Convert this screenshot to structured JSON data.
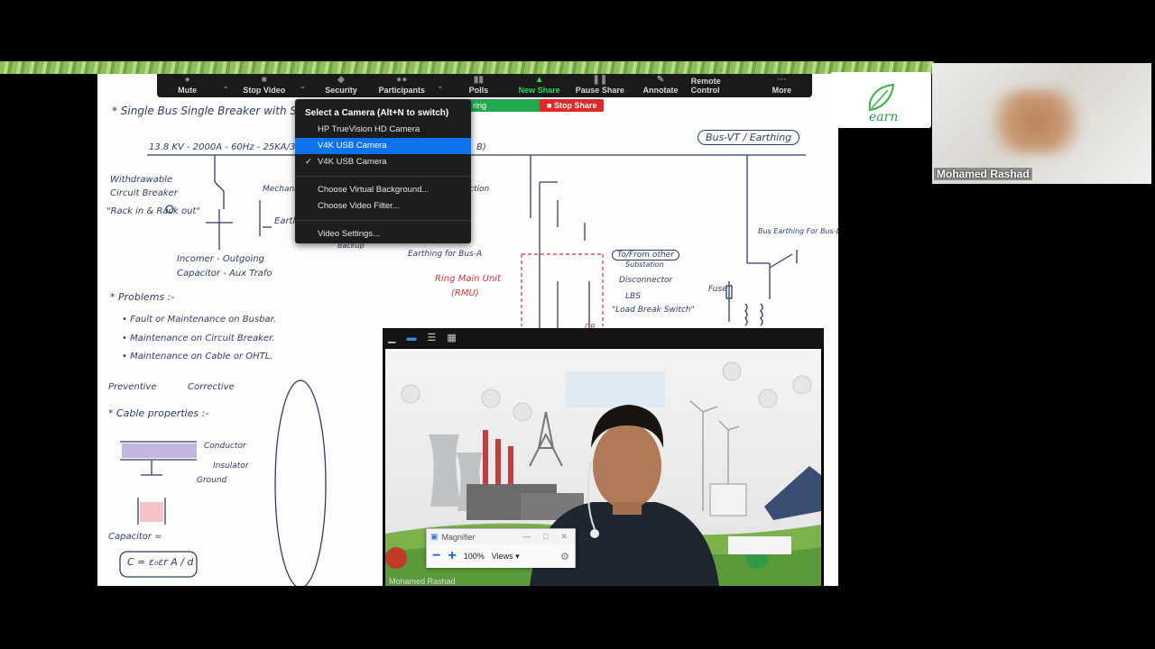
{
  "toolbar": {
    "items": [
      {
        "label": "Mute",
        "icon": "microphone-icon"
      },
      {
        "label": "Stop Video",
        "icon": "video-camera-icon"
      },
      {
        "label": "Security",
        "icon": "shield-icon"
      },
      {
        "label": "Participants",
        "icon": "participants-icon"
      },
      {
        "label": "Polls",
        "icon": "polls-icon"
      },
      {
        "label": "New Share",
        "icon": "share-arrow-icon"
      },
      {
        "label": "Pause Share",
        "icon": "pause-icon"
      },
      {
        "label": "Annotate",
        "icon": "pen-icon"
      },
      {
        "label": "Remote Control",
        "icon": "mouse-icon"
      },
      {
        "label": "More",
        "icon": "ellipsis-icon"
      }
    ],
    "accent": "#23d959"
  },
  "share": {
    "status": "ring",
    "stop_label": "Stop Share",
    "stop_color": "#e02828"
  },
  "camera_menu": {
    "title": "Select a Camera (Alt+N to switch)",
    "cameras": [
      "HP TrueVision HD Camera",
      "V4K USB Camera",
      "V4K USB Camera"
    ],
    "highlighted_index": 1,
    "checked_index": 2,
    "options": [
      "Choose Virtual Background...",
      "Choose Video Filter..."
    ],
    "settings": "Video Settings...",
    "highlight_color": "#0e72ed"
  },
  "logo": {
    "text": "earn"
  },
  "thumbnail": {
    "name": "Mohamed Rashad"
  },
  "video_window": {
    "name": "Mohamed Rashad"
  },
  "magnifier": {
    "title": "Magnifier",
    "zoom": "100%",
    "views": "Views ▾"
  },
  "whiteboard": {
    "title": "* Single Bus Single Breaker with Se",
    "rating": "13.8 KV - 2000A - 60Hz - 25KA/3",
    "bus_label": "B)",
    "bus_vt": "Bus-VT / Earthing",
    "withdrawable": "Withdrawable",
    "circuit_breaker": "Circuit Breaker",
    "rack": "\"Rack in & Rack out\"",
    "mechanic": "Mechani",
    "earth": "Earth",
    "incomer": "Incomer - Outgoing",
    "capacitor_aux": "Capacitor - Aux Trafo",
    "earthing_bus_a": "Earthing for Bus-A",
    "backup": "Backup",
    "ring_main": "Ring Main Unit",
    "rmu": "(RMU)",
    "to_from": "To/From other",
    "substation": "Substation",
    "disconnector": "Disconnector",
    "lbs": "LBS",
    "load_break": "\"Load Break Switch\"",
    "ction": "ction",
    "bus_earthing": "Bus Earthing For Bus-B",
    "fuse": "Fuse",
    "problems": "* Problems :-",
    "p1": "• Fault or Maintenance on Busbar.",
    "p2": "• Maintenance on Circuit Breaker.",
    "p3": "• Maintenance on Cable or OHTL.",
    "preventive": "Preventive",
    "corrective": "Corrective",
    "cable_props": "* Cable properties :-",
    "conductor": "Conductor",
    "insulator": "Insulator",
    "ground": "Ground",
    "capacitor_eq": "Capacitor =",
    "c_formula": "C = ε₀εr A / d",
    "gr": "GR"
  }
}
